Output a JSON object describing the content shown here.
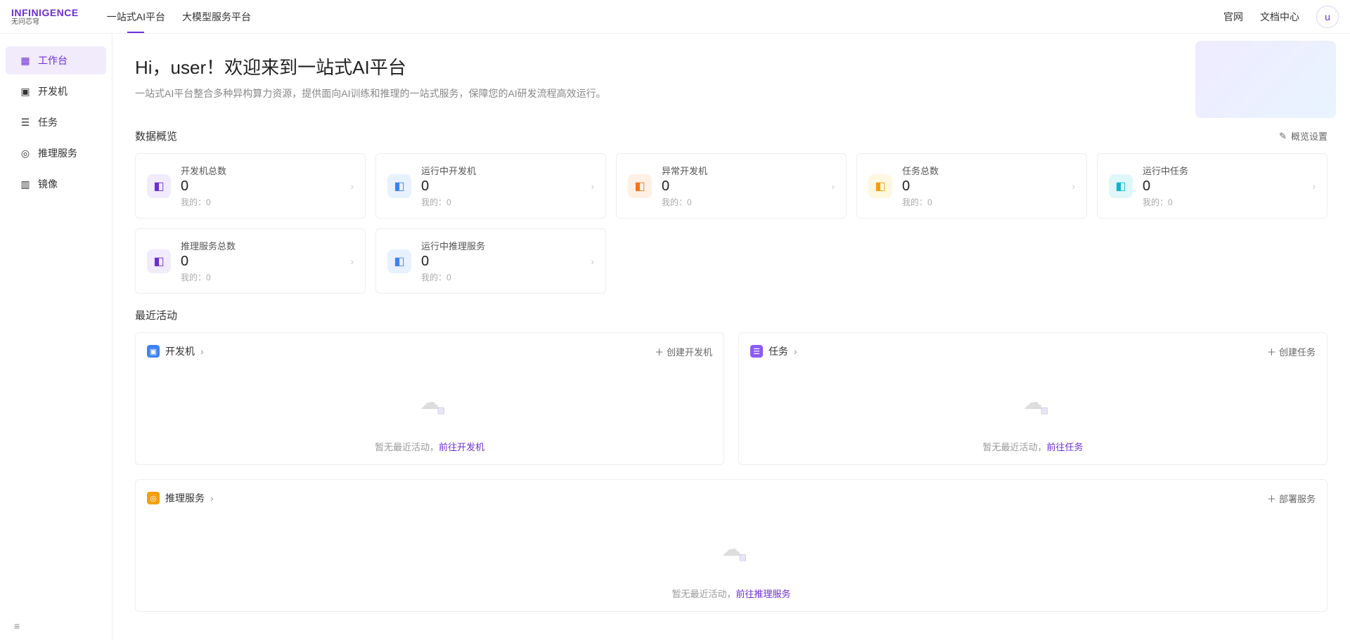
{
  "brand": {
    "top": "INFINIGENCE",
    "bottom": "无问芯穹"
  },
  "topTabs": [
    {
      "label": "一站式AI平台",
      "active": true
    },
    {
      "label": "大模型服务平台",
      "active": false
    }
  ],
  "headerLinks": {
    "site": "官网",
    "docs": "文档中心"
  },
  "avatar": "u",
  "sidebar": [
    {
      "label": "工作台",
      "icon": "▦",
      "active": true
    },
    {
      "label": "开发机",
      "icon": "▣",
      "active": false
    },
    {
      "label": "任务",
      "icon": "☰",
      "active": false
    },
    {
      "label": "推理服务",
      "icon": "◎",
      "active": false
    },
    {
      "label": "镜像",
      "icon": "▥",
      "active": false
    }
  ],
  "hero": {
    "title": "Hi，user！欢迎来到一站式AI平台",
    "subtitle": "一站式AI平台整合多种异构算力资源，提供面向AI训练和推理的一站式服务，保障您的AI研发流程高效运行。"
  },
  "overview": {
    "title": "数据概览",
    "settings": "概览设置",
    "cards": [
      {
        "label": "开发机总数",
        "value": "0",
        "sub": "我的：0",
        "color": "purple"
      },
      {
        "label": "运行中开发机",
        "value": "0",
        "sub": "我的：0",
        "color": "blue"
      },
      {
        "label": "异常开发机",
        "value": "0",
        "sub": "我的：0",
        "color": "orange"
      },
      {
        "label": "任务总数",
        "value": "0",
        "sub": "我的：0",
        "color": "yellow"
      },
      {
        "label": "运行中任务",
        "value": "0",
        "sub": "我的：0",
        "color": "cyan"
      },
      {
        "label": "推理服务总数",
        "value": "0",
        "sub": "我的：0",
        "color": "purple"
      },
      {
        "label": "运行中推理服务",
        "value": "0",
        "sub": "我的：0",
        "color": "blue"
      }
    ]
  },
  "recent": {
    "title": "最近活动",
    "sections": [
      {
        "title": "开发机",
        "ico": "▣",
        "icoColor": "#3b82f6",
        "action": "创建开发机",
        "emptyText": "暂无最近活动，",
        "link": "前往开发机"
      },
      {
        "title": "任务",
        "ico": "☰",
        "icoColor": "#8b5cf6",
        "action": "创建任务",
        "emptyText": "暂无最近活动，",
        "link": "前往任务"
      },
      {
        "title": "推理服务",
        "ico": "◎",
        "icoColor": "#f59e0b",
        "action": "部署服务",
        "emptyText": "暂无最近活动，",
        "link": "前往推理服务",
        "full": true
      }
    ]
  }
}
